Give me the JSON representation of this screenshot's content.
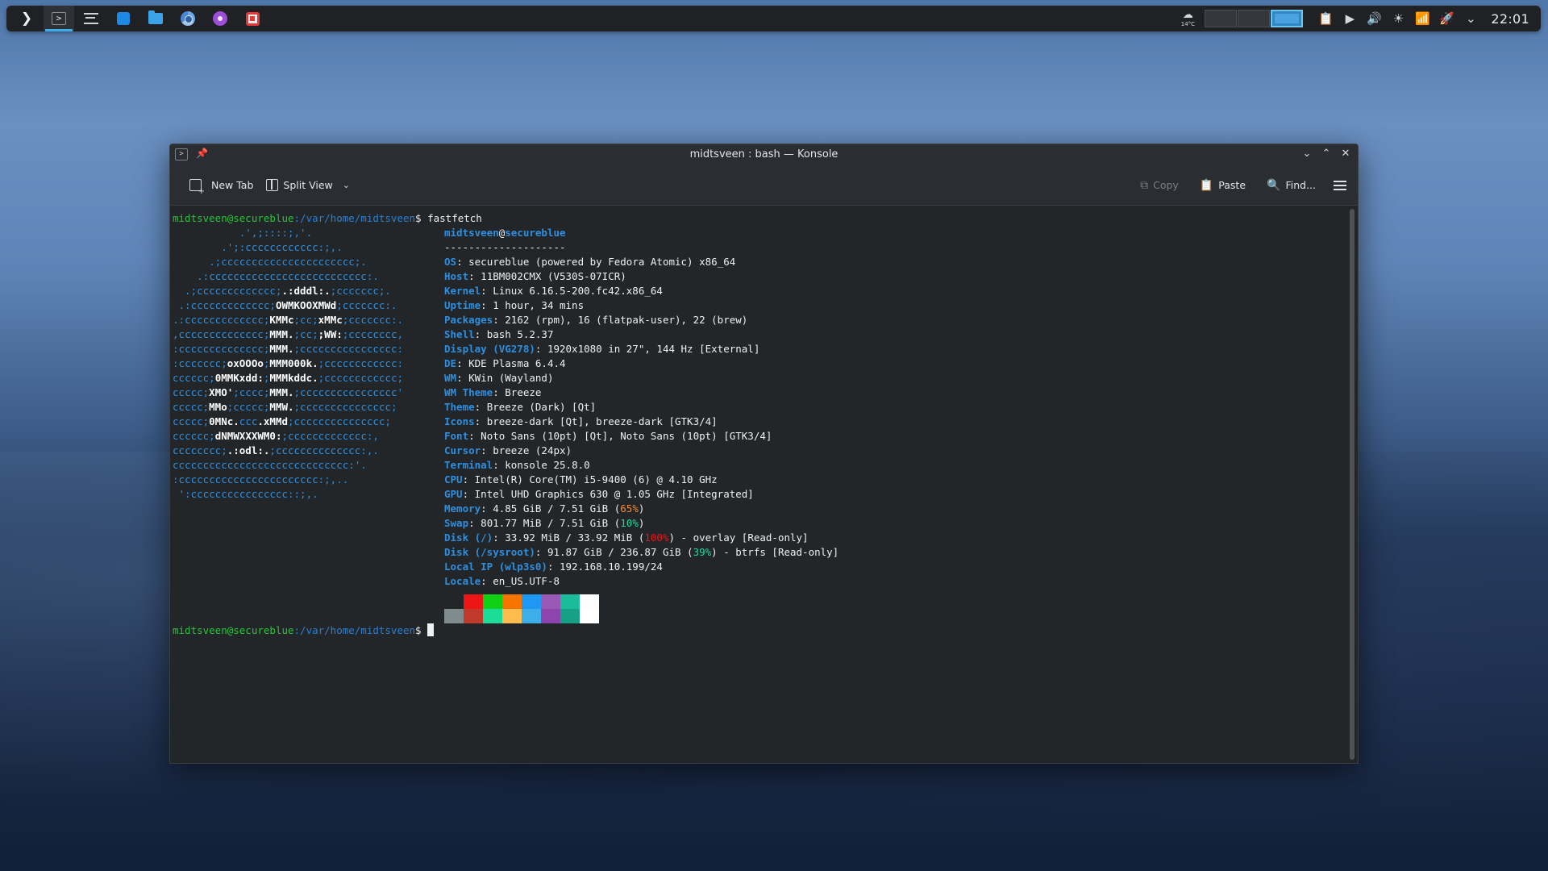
{
  "taskbar": {
    "clock": "22:01",
    "weather_temp": "14°C",
    "apps": [
      "application-launcher",
      "konsole",
      "system-monitor",
      "software-store",
      "file-manager",
      "chromium",
      "media-app",
      "flatseal"
    ]
  },
  "window": {
    "title": "midtsveen : bash — Konsole"
  },
  "toolbar": {
    "new_tab": "New Tab",
    "split_view": "Split View",
    "copy": "Copy",
    "paste": "Paste",
    "find": "Find..."
  },
  "terminal": {
    "prompt_user_host": "midtsveen@secureblue",
    "prompt_path": ":/var/home/midtsveen",
    "prompt_symbol": "$",
    "command": " fastfetch",
    "logo": [
      {
        "t": "           .',;::::;,'."
      },
      {
        "t": "        .';:cccccccccccc:;,."
      },
      {
        "t": "      .;cccccccccccccccccccccc;."
      },
      {
        "t": "    .:cccccccccccccccccccccccccc:."
      },
      {
        "t": "  .;ccccccccccccc;",
        "b": ".:dddl:.",
        "t2": ";ccccccc;."
      },
      {
        "t": " .:ccccccccccccc;",
        "b": "OWMKOOXMWd",
        "t2": ";ccccccc:."
      },
      {
        "t": ".:ccccccccccccc;",
        "b": "KMMc",
        "t2": ";cc;",
        "b2": "xMMc",
        "t3": ";ccccccc:."
      },
      {
        "t": ",cccccccccccccc;",
        "b": "MMM.",
        "t2": ";cc;",
        "b2": ";WW:",
        "t3": ";cccccccc,"
      },
      {
        "t": ":cccccccccccccc;",
        "b": "MMM.",
        "t2": ";cccccccccccccccc:"
      },
      {
        "t": ":ccccccc;",
        "b": "oxOOOo",
        "t2": ";",
        "b2": "MMM000k.",
        "t3": ";cccccccccccc:"
      },
      {
        "t": "cccccc;",
        "b": "0MMKxdd:",
        "t2": ";",
        "b2": "MMMkddc.",
        "t3": ";cccccccccccc;"
      },
      {
        "t": "ccccc;",
        "b": "XMO'",
        "t2": ";cccc;",
        "b2": "MMM.",
        "t3": ";cccccccccccccccc'"
      },
      {
        "t": "ccccc;",
        "b": "MMo",
        "t2": ";ccccc;",
        "b2": "MMW.",
        "t3": ";ccccccccccccccc;"
      },
      {
        "t": "ccccc;",
        "b": "0MNc.",
        "t2": "ccc",
        "b2": ".xMMd",
        "t3": ";ccccccccccccccc;"
      },
      {
        "t": "cccccc;",
        "b": "dNMWXXXWM0:",
        "t2": ";ccccccccccccc:,"
      },
      {
        "t": "cccccccc;",
        "b": ".:odl:.",
        "t2": ";cccccccccccccc:,."
      },
      {
        "t": "ccccccccccccccccccccccccccccc:'."
      },
      {
        "t": ":ccccccccccccccccccccccc:;,.."
      },
      {
        "t": " ':cccccccccccccccc::;,."
      }
    ],
    "info_header_user": "midtsveen",
    "info_header_at": "@",
    "info_header_host": "secureblue",
    "separator": "--------------------",
    "info": [
      {
        "key": "OS",
        "value": "secureblue (powered by Fedora Atomic) x86_64"
      },
      {
        "key": "Host",
        "value": "11BM002CMX (V530S-07ICR)"
      },
      {
        "key": "Kernel",
        "value": "Linux 6.16.5-200.fc42.x86_64"
      },
      {
        "key": "Uptime",
        "value": "1 hour, 34 mins"
      },
      {
        "key": "Packages",
        "value": "2162 (rpm), 16 (flatpak-user), 22 (brew)"
      },
      {
        "key": "Shell",
        "value": "bash 5.2.37"
      },
      {
        "key": "Display (VG278)",
        "value": "1920x1080 in 27\", 144 Hz [External]"
      },
      {
        "key": "DE",
        "value": "KDE Plasma 6.4.4"
      },
      {
        "key": "WM",
        "value": "KWin (Wayland)"
      },
      {
        "key": "WM Theme",
        "value": "Breeze"
      },
      {
        "key": "Theme",
        "value": "Breeze (Dark) [Qt]"
      },
      {
        "key": "Icons",
        "value": "breeze-dark [Qt], breeze-dark [GTK3/4]"
      },
      {
        "key": "Font",
        "value": "Noto Sans (10pt) [Qt], Noto Sans (10pt) [GTK3/4]"
      },
      {
        "key": "Cursor",
        "value": "breeze (24px)"
      },
      {
        "key": "Terminal",
        "value": "konsole 25.8.0"
      },
      {
        "key": "CPU",
        "value": "Intel(R) Core(TM) i5-9400 (6) @ 4.10 GHz"
      },
      {
        "key": "GPU",
        "value": "Intel UHD Graphics 630 @ 1.05 GHz [Integrated]"
      },
      {
        "key": "Memory",
        "value": "4.85 GiB / 7.51 GiB (",
        "pct": "65%",
        "pct_class": "pct-warn",
        "tail": ")"
      },
      {
        "key": "Swap",
        "value": "801.77 MiB / 7.51 GiB (",
        "pct": "10%",
        "pct_class": "pct-ok",
        "tail": ")"
      },
      {
        "key": "Disk (/)",
        "value": "33.92 MiB / 33.92 MiB (",
        "pct": "100%",
        "pct_class": "pct-bad",
        "tail": ") - overlay [Read-only]"
      },
      {
        "key": "Disk (/sysroot)",
        "value": "91.87 GiB / 236.87 GiB (",
        "pct": "39%",
        "pct_class": "pct-ok",
        "tail": ") - btrfs [Read-only]"
      },
      {
        "key": "Local IP (wlp3s0)",
        "value": "192.168.10.199/24"
      },
      {
        "key": "Locale",
        "value": "en_US.UTF-8"
      }
    ],
    "palette_top": [
      "#232627",
      "#ed1515",
      "#11d116",
      "#f67400",
      "#1d99f3",
      "#9b59b6",
      "#1abc9c",
      "#fcfcfc"
    ],
    "palette_bottom": [
      "#7f8c8d",
      "#c0392b",
      "#1cdc9a",
      "#fdbc4b",
      "#3daee9",
      "#8e44ad",
      "#16a085",
      "#ffffff"
    ]
  }
}
